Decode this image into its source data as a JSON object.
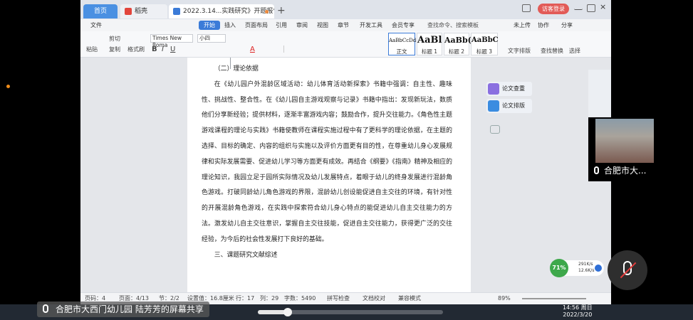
{
  "tabs": {
    "home": "首页",
    "daoke": "稻壳",
    "doc": "2022.3.14...实践研究》开题报告"
  },
  "titlebar": {
    "visitor_login": "访客登录"
  },
  "menu": [
    "文件",
    "开始",
    "插入",
    "页面布局",
    "引用",
    "审阅",
    "视图",
    "章节",
    "开发工具",
    "会员专享"
  ],
  "menu_search": "查找命令、搜索模板",
  "menu_right": {
    "not_uploaded": "未上传",
    "collab": "协作",
    "share": "分享"
  },
  "toolbar": {
    "cut": "剪切",
    "copy": "复制",
    "paste": "粘贴",
    "format_painter": "格式刷",
    "font_name": "Times New Roma",
    "font_size": "小四",
    "styles": [
      {
        "sample": "AaBbCcDd",
        "name": "正文"
      },
      {
        "sample": "AaBl",
        "name": "标题 1"
      },
      {
        "sample": "AaBb(",
        "name": "标题 2"
      },
      {
        "sample": "AaBbC",
        "name": "标题 3"
      }
    ],
    "text_layout": "文字排版",
    "find_replace": "查找替换",
    "select": "选择"
  },
  "document": {
    "heading1": "（二）理论依据",
    "paragraph1": "在《幼儿园户外混龄区域活动：幼儿体育活动新探索》书籍中强调：自主性、趣味性、挑战性、整合性。在《幼儿园自主游戏观察与记录》书籍中指出：发现新玩法，数质他们分享新经验；提供材料，逐渐丰富游戏内容；鼓励合作，提升交往能力。《角色性主题游戏课程的理论与实践》书籍使教师在课程实施过程中有了更科学的理论依据，在主题的选择、目标的确定、内容的组织与实施以及评价方面更有目的性，在尊重幼儿身心发展规律和实际发展需要、促进幼儿学习等方面更有成效。再结合《纲要》《指南》精神及相应的理论知识，我园立足于园所实际情况及幼儿发展特点，着眼于幼儿的终身发展进行混龄角色游戏。打破同龄幼儿角色游戏的界限，混龄幼儿创设能促进自主交往的环境，有针对性的开展混龄角色游戏，在实践中探索符合幼儿身心特点的能促进幼儿自主交往能力的方法。激发幼儿自主交往意识，掌握自主交往技能，促进自主交往能力，获得更广泛的交往经验，为今后的社会性发展打下良好的基础。",
    "heading2": "三、课题研究文献综述"
  },
  "side_panel": {
    "check": "论文查重",
    "layout": "论文排版"
  },
  "statusbar": {
    "page": "页码：4",
    "pages": "页面：4/13",
    "section": "节：2/2",
    "position": "设置值：16.8厘米",
    "line": "行：17",
    "col": "列：29",
    "words": "字数：5490",
    "spell": "拼写检查",
    "proof": "文档校对",
    "compat": "兼容模式",
    "zoom": "89%"
  },
  "video": {
    "name": "合肥市大..."
  },
  "share_bar": {
    "text": "合肥市大西门幼儿园 陆芳芳的屏幕共享"
  },
  "network": {
    "percent": "71%",
    "down": "291K/s",
    "up": "12.6K/s"
  },
  "clock": {
    "time": "14:56 周日",
    "date": "2022/3/20"
  },
  "progress": {
    "fraction": 0.16
  },
  "colors": {
    "accent": "#3b7bd8",
    "home_tab": "#4a90e2",
    "login": "#e25b57"
  }
}
